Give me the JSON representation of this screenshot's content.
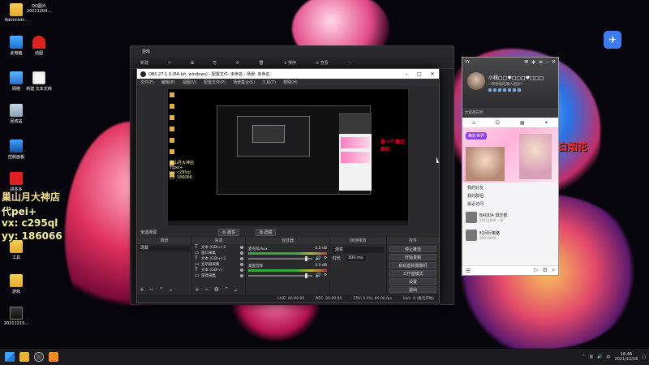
{
  "desktop": {
    "icons": [
      {
        "label": "Administr..."
      },
      {
        "label": "QQ图片 20211204..."
      },
      {
        "label": "此电脑"
      },
      {
        "label": "动图"
      },
      {
        "label": "网络"
      },
      {
        "label": "新建 文本文档"
      },
      {
        "label": "回收站"
      },
      {
        "label": "控制面板"
      },
      {
        "label": "拼多多"
      },
      {
        "label": "工具"
      },
      {
        "label": "游戏"
      },
      {
        "label": "20211215..."
      }
    ],
    "overlay": {
      "line1": "巢山月大神店",
      "line2": "代pei+",
      "line3": "vx: c295ql",
      "line4": "yy: 186066",
      "right": "首一个暮白烟花"
    }
  },
  "explorer": {
    "title": "游戏",
    "toolbar": [
      "新建",
      "✂",
      "⧉",
      "⎘",
      "⟳",
      "🗑",
      "↕ 排序",
      "≡ 查看",
      "···"
    ]
  },
  "obs": {
    "title": "OBS 27.1.3 (64-bit, windows) - 配置文件: 未命名 - 场景: 未命名",
    "menu": [
      "文件(F)",
      "编辑(E)",
      "视图(V)",
      "配置文件(P)",
      "场景集合(S)",
      "工具(T)",
      "帮助(H)"
    ],
    "preview_text_red": "首一个暮白烟花",
    "preview_text_yellow": [
      "巢山月大神店",
      "代pei+",
      "vx: c295ql",
      "yy: 186066"
    ],
    "no_source": "未选择源",
    "props_btn": "属性",
    "filters_btn": "滤镜",
    "docks": {
      "scenes": {
        "header": "场景",
        "items": [
          "场景"
        ]
      },
      "sources": {
        "header": "来源",
        "items": [
          {
            "icon": "T",
            "label": "文本 (GDI+) 2"
          },
          {
            "icon": "▭",
            "label": "窗口采集"
          },
          {
            "icon": "T",
            "label": "文本 (GDI+) 2"
          },
          {
            "icon": "▭",
            "label": "显示器采集"
          },
          {
            "icon": "T",
            "label": "文本 (GDI+)"
          },
          {
            "icon": "▭",
            "label": "游戏采集"
          }
        ]
      },
      "mixer": {
        "header": "混音器",
        "channels": [
          {
            "name": "麦克风/Aux",
            "db": "0.0 dB"
          },
          {
            "name": "桌面音频",
            "db": "0.0 dB"
          }
        ]
      },
      "transitions": {
        "header": "转场特效",
        "selected": "渐变",
        "duration_label": "时长",
        "duration_value": "300 ms"
      },
      "controls": {
        "header": "控件",
        "buttons": [
          "停止推流",
          "开始录制",
          "启动虚拟摄像机",
          "工作室模式",
          "设置",
          "退出"
        ]
      }
    },
    "status": {
      "live": "LIVE: 00:00:00",
      "rec": "REC: 00:00:00",
      "cpu": "CPU: 0.0%, 60.00 fps",
      "kbps": "kb/s: 0 (推流开始)"
    }
  },
  "qq": {
    "tag": "YY",
    "nick": "小桃□□♥□□□♥□□□",
    "signature": "~带你去吃喝人逛买~",
    "search_hint": "大家都在听",
    "banner_caption": "精彩世界",
    "group_friends": "我的好友",
    "group_groups": "我的群组",
    "group_recent": "最近访问",
    "recent_items": [
      {
        "title": "BAODA 俱乐部",
        "sub": "20211026 · 10"
      },
      {
        "title": "时间行策路",
        "sub": "20210609"
      }
    ]
  },
  "taskbar": {
    "time": "16:46",
    "date": "2021/12/16"
  }
}
